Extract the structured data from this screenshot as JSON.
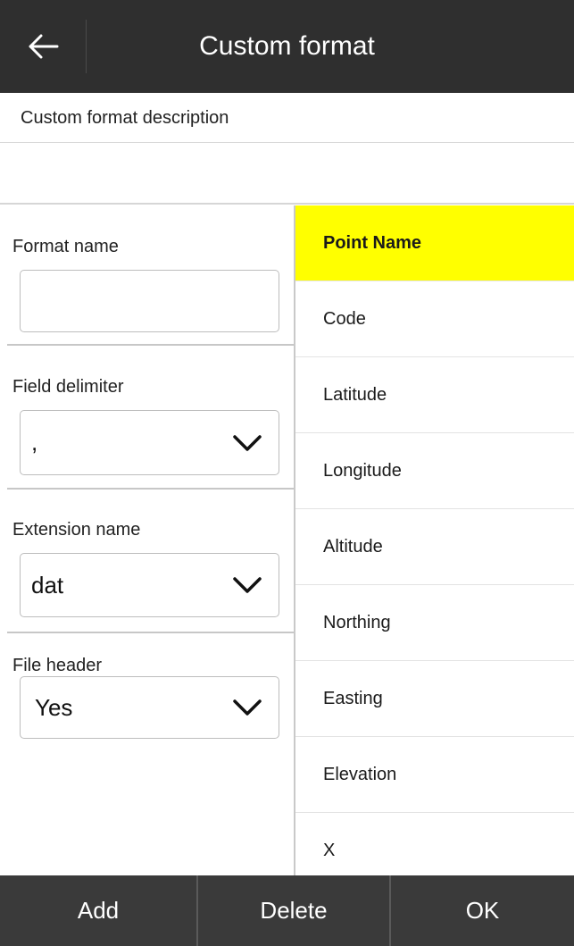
{
  "header": {
    "title": "Custom format",
    "back_icon": "arrow-left-icon"
  },
  "description": {
    "label": "Custom format description",
    "value": ""
  },
  "form": {
    "format_name": {
      "label": "Format name",
      "value": ""
    },
    "field_delimiter": {
      "label": "Field delimiter",
      "value": ","
    },
    "extension_name": {
      "label": "Extension name",
      "value": "dat"
    },
    "file_header": {
      "label": "File header",
      "value": "Yes"
    }
  },
  "fields": [
    {
      "label": "Point Name",
      "selected": true
    },
    {
      "label": "Code"
    },
    {
      "label": "Latitude"
    },
    {
      "label": "Longitude"
    },
    {
      "label": "Altitude"
    },
    {
      "label": "Northing"
    },
    {
      "label": "Easting"
    },
    {
      "label": "Elevation"
    },
    {
      "label": "X"
    }
  ],
  "footer": {
    "add": "Add",
    "delete": "Delete",
    "ok": "OK"
  },
  "colors": {
    "header_bg": "#2f2f2f",
    "selected_bg": "#ffff00",
    "footer_bg": "#3a3a3a"
  }
}
